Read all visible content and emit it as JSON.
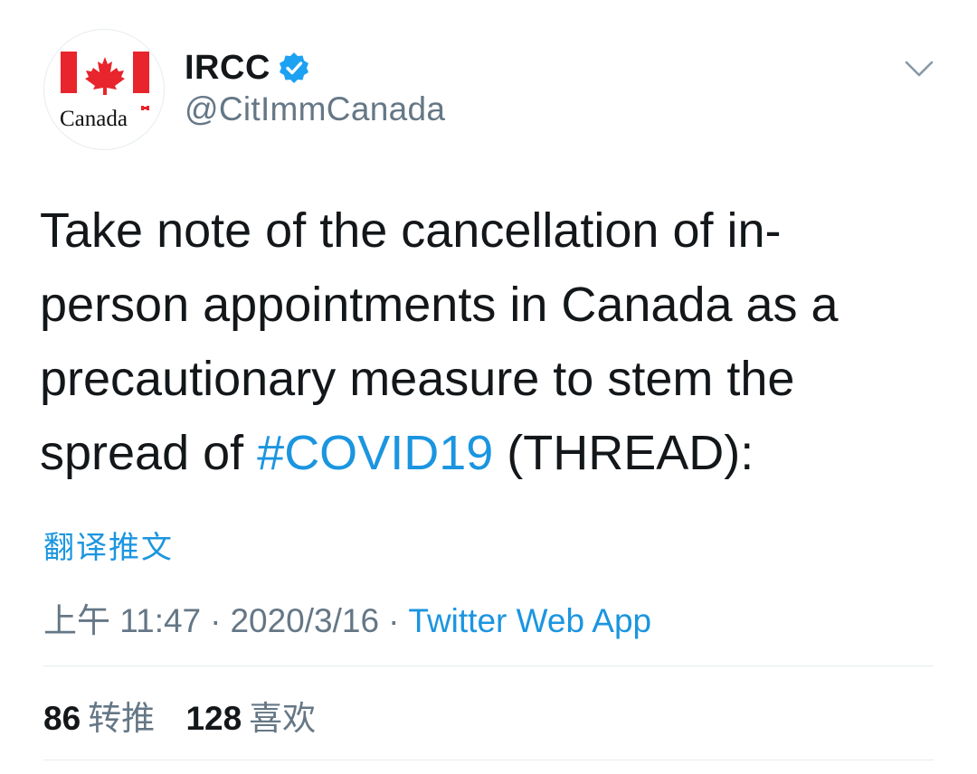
{
  "tweet": {
    "author": {
      "display_name": "IRCC",
      "handle": "@CitImmCanada",
      "verified": true,
      "avatar_wordmark": "Canada"
    },
    "text_parts": {
      "line1": "Take note of the cancellation of in-",
      "line2": "person appointments in Canada as a",
      "line3": "precautionary measure to stem the",
      "line4_prefix": "spread of ",
      "hashtag": "#COVID19",
      "line4_suffix": " (THREAD):"
    },
    "translate_label": "翻译推文",
    "time": "上午 11:47",
    "separator": "·",
    "date": "2020/3/16",
    "source": "Twitter Web App",
    "stats": {
      "retweets_count": "86",
      "retweets_label": "转推",
      "likes_count": "128",
      "likes_label": "喜欢"
    }
  },
  "icons": {
    "verified_badge": "verified-badge-icon",
    "caret": "chevron-down-icon"
  },
  "colors": {
    "link_blue": "#1b95e0",
    "text_primary": "#14171a",
    "text_secondary": "#657786",
    "divider": "#e6ecf0",
    "flag_red": "#e8242c"
  }
}
